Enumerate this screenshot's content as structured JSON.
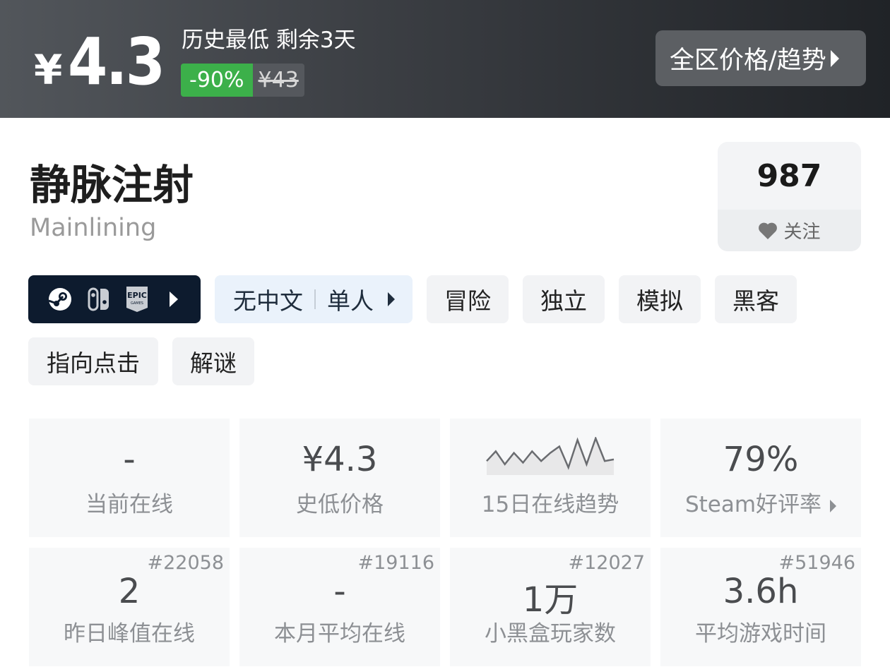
{
  "banner": {
    "currency": "¥",
    "price": "4.3",
    "history_low": "历史最低 剩余3天",
    "discount": "-90%",
    "original_price": "¥43",
    "region_button": "全区价格/趋势"
  },
  "game": {
    "title": "静脉注射",
    "subtitle": "Mainlining",
    "follow_count": "987",
    "follow_label": "关注"
  },
  "platforms": [
    "steam-icon",
    "switch-icon",
    "epic-icon"
  ],
  "language": {
    "lang": "无中文",
    "mode": "单人"
  },
  "tags": [
    "冒险",
    "独立",
    "模拟",
    "黑客",
    "指向点击",
    "解谜"
  ],
  "stats_row1": [
    {
      "value": "-",
      "label": "当前在线"
    },
    {
      "value": "¥4.3",
      "label": "史低价格"
    },
    {
      "value": "",
      "label": "15日在线趋势"
    },
    {
      "value": "79%",
      "label": "Steam好评率"
    }
  ],
  "stats_row2": [
    {
      "rank": "#22058",
      "value": "2",
      "label": "昨日峰值在线"
    },
    {
      "rank": "#19116",
      "value": "-",
      "label": "本月平均在线"
    },
    {
      "rank": "#12027",
      "value": "1万",
      "label": "小黑盒玩家数"
    },
    {
      "rank": "#51946",
      "value": "3.6h",
      "label": "平均游戏时间"
    }
  ],
  "sparkline": [
    0.3,
    0.6,
    0.2,
    0.55,
    0.25,
    0.6,
    0.3,
    0.55,
    0.75,
    0.1,
    0.95,
    0.2,
    1.0,
    0.3,
    0.35
  ],
  "colors": {
    "discount_green": "#3cb04a",
    "platform_bg": "#0d1b2e",
    "lang_bg": "#eaf2fb"
  }
}
